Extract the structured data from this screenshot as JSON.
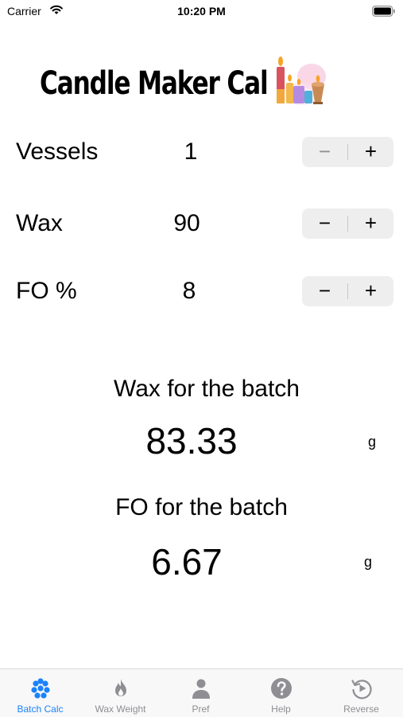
{
  "status_bar": {
    "carrier": "Carrier",
    "time": "10:20 PM"
  },
  "app": {
    "title": "Candle Maker Cal"
  },
  "inputs": [
    {
      "label": "Vessels",
      "value": "1",
      "minus": "−",
      "plus": "+"
    },
    {
      "label": "Wax",
      "value": "90",
      "minus": "−",
      "plus": "+"
    },
    {
      "label": "FO %",
      "value": "8",
      "minus": "−",
      "plus": "+"
    }
  ],
  "results": {
    "wax": {
      "label": "Wax for the batch",
      "value": "83.33",
      "unit": "g"
    },
    "fo": {
      "label": "FO for the batch",
      "value": "6.67",
      "unit": "g"
    }
  },
  "tabs": [
    {
      "label": "Batch Calc",
      "icon": "batch-calc-icon",
      "active": true
    },
    {
      "label": "Wax Weight",
      "icon": "flame-icon",
      "active": false
    },
    {
      "label": "Pref",
      "icon": "person-icon",
      "active": false
    },
    {
      "label": "Help",
      "icon": "question-icon",
      "active": false
    },
    {
      "label": "Reverse",
      "icon": "reverse-icon",
      "active": false
    }
  ],
  "colors": {
    "accent": "#1a82fb",
    "inactive": "#8e8e93",
    "stepper_bg": "#eeeeef"
  }
}
